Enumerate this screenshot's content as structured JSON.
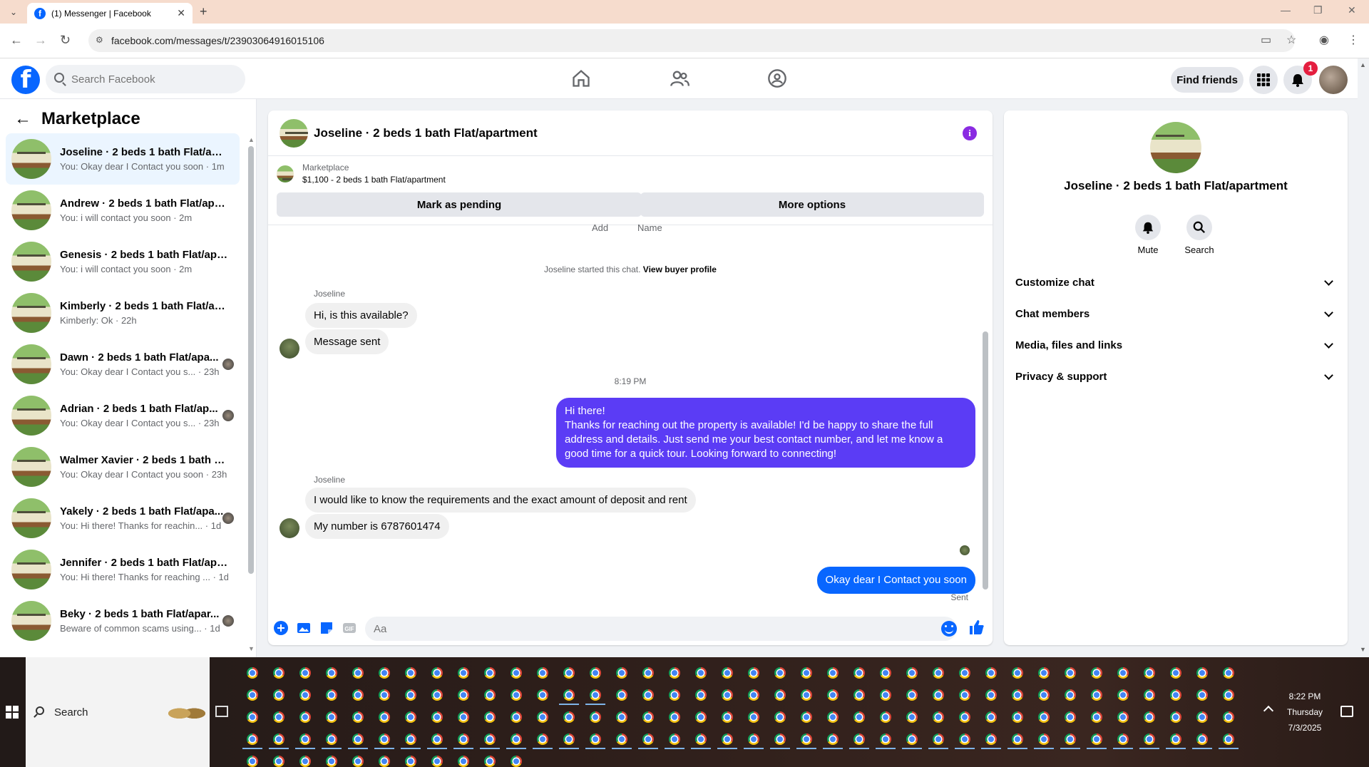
{
  "browser": {
    "tab_title": "(1) Messenger | Facebook",
    "url": "facebook.com/messages/t/23903064916015106"
  },
  "header": {
    "search_placeholder": "Search Facebook",
    "find_friends": "Find friends",
    "notification_count": "1"
  },
  "sidebar": {
    "title": "Marketplace",
    "conversations": [
      {
        "name": "Joseline · 2 beds 1 bath Flat/apa...",
        "snippet": "You: Okay dear I Contact you soon · 1m"
      },
      {
        "name": "Andrew · 2 beds 1 bath Flat/apar...",
        "snippet": "You: i will contact you soon · 2m"
      },
      {
        "name": "Genesis · 2 beds 1 bath Flat/apar...",
        "snippet": "You: i will contact you soon · 2m"
      },
      {
        "name": "Kimberly · 2 beds 1 bath Flat/ap...",
        "snippet": "Kimberly: Ok · 22h"
      },
      {
        "name": "Dawn · 2 beds 1 bath Flat/apa...",
        "snippet": "You: Okay dear I Contact you s... · 23h"
      },
      {
        "name": "Adrian · 2 beds 1 bath Flat/ap...",
        "snippet": "You: Okay dear I Contact you s... · 23h"
      },
      {
        "name": "Walmer Xavier · 2 beds 1 bath Fl...",
        "snippet": "You: Okay dear I Contact you soon · 23h"
      },
      {
        "name": "Yakely · 2 beds 1 bath Flat/apa...",
        "snippet": "You: Hi there! Thanks for reachin... · 1d"
      },
      {
        "name": "Jennifer · 2 beds 1 bath Flat/apa...",
        "snippet": "You: Hi there! Thanks for reaching ... · 1d"
      },
      {
        "name": "Beky · 2 beds 1 bath Flat/apar...",
        "snippet": "Beware of common scams using... · 1d"
      }
    ]
  },
  "chat": {
    "title": "Joseline · 2 beds 1 bath Flat/apartment",
    "marketplace_source": "Marketplace",
    "listing": "$1,100 - 2 beds 1 bath Flat/apartment",
    "mark_pending": "Mark as pending",
    "more_options": "More options",
    "cut_label_1": "Add",
    "cut_label_2": "Name",
    "system_text": "Joseline started this chat.",
    "system_link": "View buyer profile",
    "sender": "Joseline",
    "msg1": "Hi, is this available?",
    "msg2": "Message sent",
    "time_sep": "8:19 PM",
    "out_msg_1": "Hi there!",
    "out_msg_2": "Thanks for reaching out  the property is available! I'd be happy to share the full address and details. Just send me your best contact number, and let me know a good time for a quick tour. Looking forward to connecting!",
    "msg3": "I would like to know the requirements and the exact amount of deposit and rent",
    "msg4": "My number is 6787601474",
    "out_msg_3": "Okay dear I Contact you soon",
    "sent": "Sent",
    "composer_placeholder": "Aa"
  },
  "right_panel": {
    "name": "Joseline · 2 beds 1 bath Flat/apartment",
    "mute": "Mute",
    "search": "Search",
    "rows": [
      "Customize chat",
      "Chat members",
      "Media, files and links",
      "Privacy & support"
    ]
  },
  "taskbar": {
    "search": "Search",
    "time": "8:22 PM",
    "day": "Thursday",
    "date": "7/3/2025"
  }
}
